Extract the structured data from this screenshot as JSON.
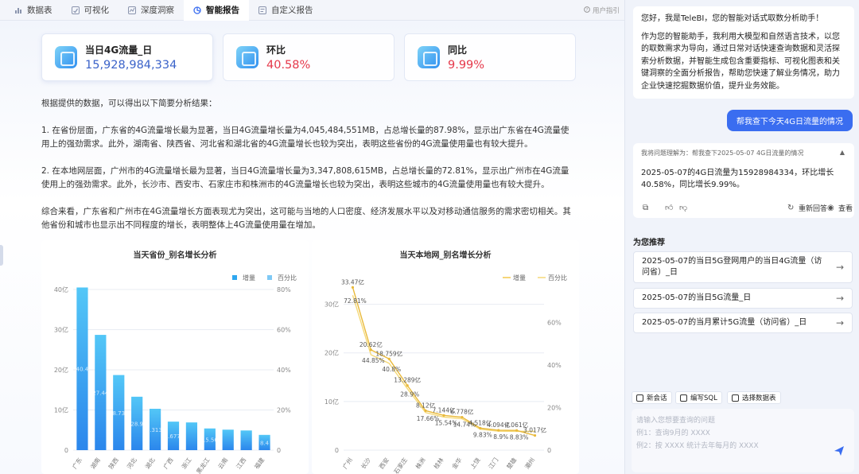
{
  "tabs": [
    {
      "label": "数据表",
      "icon": "bar-chart-icon"
    },
    {
      "label": "可视化",
      "icon": "chart-check-icon"
    },
    {
      "label": "深度洞察",
      "icon": "insight-icon"
    },
    {
      "label": "智能报告",
      "icon": "report-icon",
      "active": true
    },
    {
      "label": "自定义报告",
      "icon": "custom-report-icon"
    }
  ],
  "guide_label": "用户指引",
  "kpis": [
    {
      "label": "当日4G流量_日",
      "value": "15,928,984,334",
      "color": "#3b63c9"
    },
    {
      "label": "环比",
      "value": "40.58%",
      "color": "#e5384a"
    },
    {
      "label": "同比",
      "value": "9.99%",
      "color": "#e5384a"
    }
  ],
  "analysis": {
    "intro": "根据提供的数据，可以得出以下简要分析结果：",
    "p1": "1. 在省份层面，广东省的4G流量增长最为显著，当日4G流量增长量为4,045,484,551MB，占总增长量的87.98%，显示出广东省在4G流量使用上的强劲需求。此外，湖南省、陕西省、河北省和湖北省的4G流量增长也较为突出，表明这些省份的4G流量使用量也有较大提升。",
    "p2": "2. 在本地网层面，广州市的4G流量增长最为显著，当日4G流量增长量为3,347,808,615MB，占总增长量的72.81%，显示出广州市在4G流量使用上的强劲需求。此外，长沙市、西安市、石家庄市和株洲市的4G流量增长也较为突出，表明这些城市的4G流量使用量也有较大提升。",
    "p3": "综合来看，广东省和广州市在4G流量增长方面表现尤为突出，这可能与当地的人口密度、经济发展水平以及对移动通信服务的需求密切相关。其他省份和城市也显示出不同程度的增长，表明整体上4G流量使用量在增加。"
  },
  "chart_data": [
    {
      "type": "bar",
      "title": "当天省份_别名增长分析",
      "legend": [
        "增量",
        "百分比"
      ],
      "legend_position": "top-right",
      "categories": [
        "广东",
        "湖南",
        "陕西",
        "河北",
        "湖北",
        "广西",
        "浙江",
        "黑龙江",
        "云南",
        "江西",
        "福建"
      ],
      "series": [
        {
          "name": "增量",
          "values": [
            40.5,
            28.7,
            18.7,
            13.3,
            10.3,
            7.1,
            6.9,
            5.4,
            5.1,
            4.9,
            3.8
          ]
        }
      ],
      "value_labels": [
        "40.4",
        "27.44",
        "18.735",
        "28.9",
        "10.313亿",
        "15.677亿",
        "",
        "15.56",
        "",
        "",
        "8.4"
      ],
      "y_left": {
        "ticks": [
          "0",
          "10亿",
          "20亿",
          "30亿",
          "40亿"
        ],
        "max": 40
      },
      "y_right": {
        "ticks": [
          "0",
          "20%",
          "40%",
          "60%",
          "80%"
        ],
        "max": 80
      },
      "grid": true
    },
    {
      "type": "line",
      "title": "当天本地网_别名增长分析",
      "legend": [
        "增量",
        "百分比"
      ],
      "legend_position": "top-right",
      "categories": [
        "广州",
        "长沙",
        "西安",
        "石家庄",
        "株洲",
        "桂林",
        "金华",
        "上饶",
        "江门",
        "楚雄",
        "潮州"
      ],
      "series": [
        {
          "name": "增量",
          "values": [
            33.47,
            20.62,
            18.759,
            13.289,
            8.12,
            7.144,
            6.778,
            4.518,
            4.094,
            4.061,
            3.017
          ]
        },
        {
          "name": "百分比",
          "values": [
            72.81,
            44.85,
            40.8,
            28.9,
            17.66,
            15.54,
            14.74,
            9.83,
            8.9,
            8.83,
            8.83
          ]
        }
      ],
      "value_labels": [
        "33.47亿",
        "20.62亿",
        "18.759亿",
        "13.289亿",
        "8.12亿",
        "7.144亿",
        "6.778亿",
        "4.518亿",
        "4.094亿",
        "4.061亿",
        "3.017亿"
      ],
      "pct_labels": [
        "72.81%",
        "44.85%",
        "40.8%",
        "28.9%",
        "17.66%",
        "15.54%",
        "14.74%",
        "9.83%",
        "8.9%",
        "8.83%",
        ""
      ],
      "y_left": {
        "ticks": [
          "0",
          "10亿",
          "20亿",
          "30亿"
        ],
        "max": 35
      },
      "y_right": {
        "ticks": [
          "0",
          "20%",
          "40%",
          "60%"
        ],
        "max": 80
      },
      "grid": true
    }
  ],
  "chat": {
    "greeting": "您好，我是TeleBI，您的智能对话式取数分析助手！",
    "intro": "作为您的智能助手，我利用大模型和灵活探索分析数据，并智能生成包含重要指标、可视化图表和关键洞察的全面分析报告，帮助您快速了解业务情况，助力企业快速挖掘数据价值，提升业务效能。",
    "intro_full": "作为您的智能助手，我利用大模型和自然语言技术，以您的取数需求为导向，通过日常对话快速查询数据和灵活探索分析数据，并智能生成包含重要指标、可视化图表和关键洞察的全面分析报告，帮助您快速了解业务情况，助力企业快速挖掘数据价值，提升业务效能。",
    "user_message": "帮我查下今天4G日流量的情况",
    "understood": "我将问题理解为：帮我查下2025-05-07 4G日流量的情况",
    "answer": "2025-05-07的4G日流量为15928984334，环比增长40.58%，同比增长9.99%。",
    "regenerate": "重新回答",
    "view": "查看",
    "recommend_title": "为您推荐",
    "recommendations": [
      "2025-05-07的当日5G登网用户的当日4G流量（访问省）_日",
      "2025-05-07的当日5G流量_日",
      "2025-05-07的当月累计5G流量（访问省）_日"
    ],
    "toolbar": [
      "新会话",
      "编写SQL",
      "选择数据表"
    ],
    "input_placeholder": [
      "请输入您想要查询的问题",
      "例1：查询9月的 XXXX",
      "例2：按 XXXX 统计去年每月的 XXXX"
    ]
  }
}
